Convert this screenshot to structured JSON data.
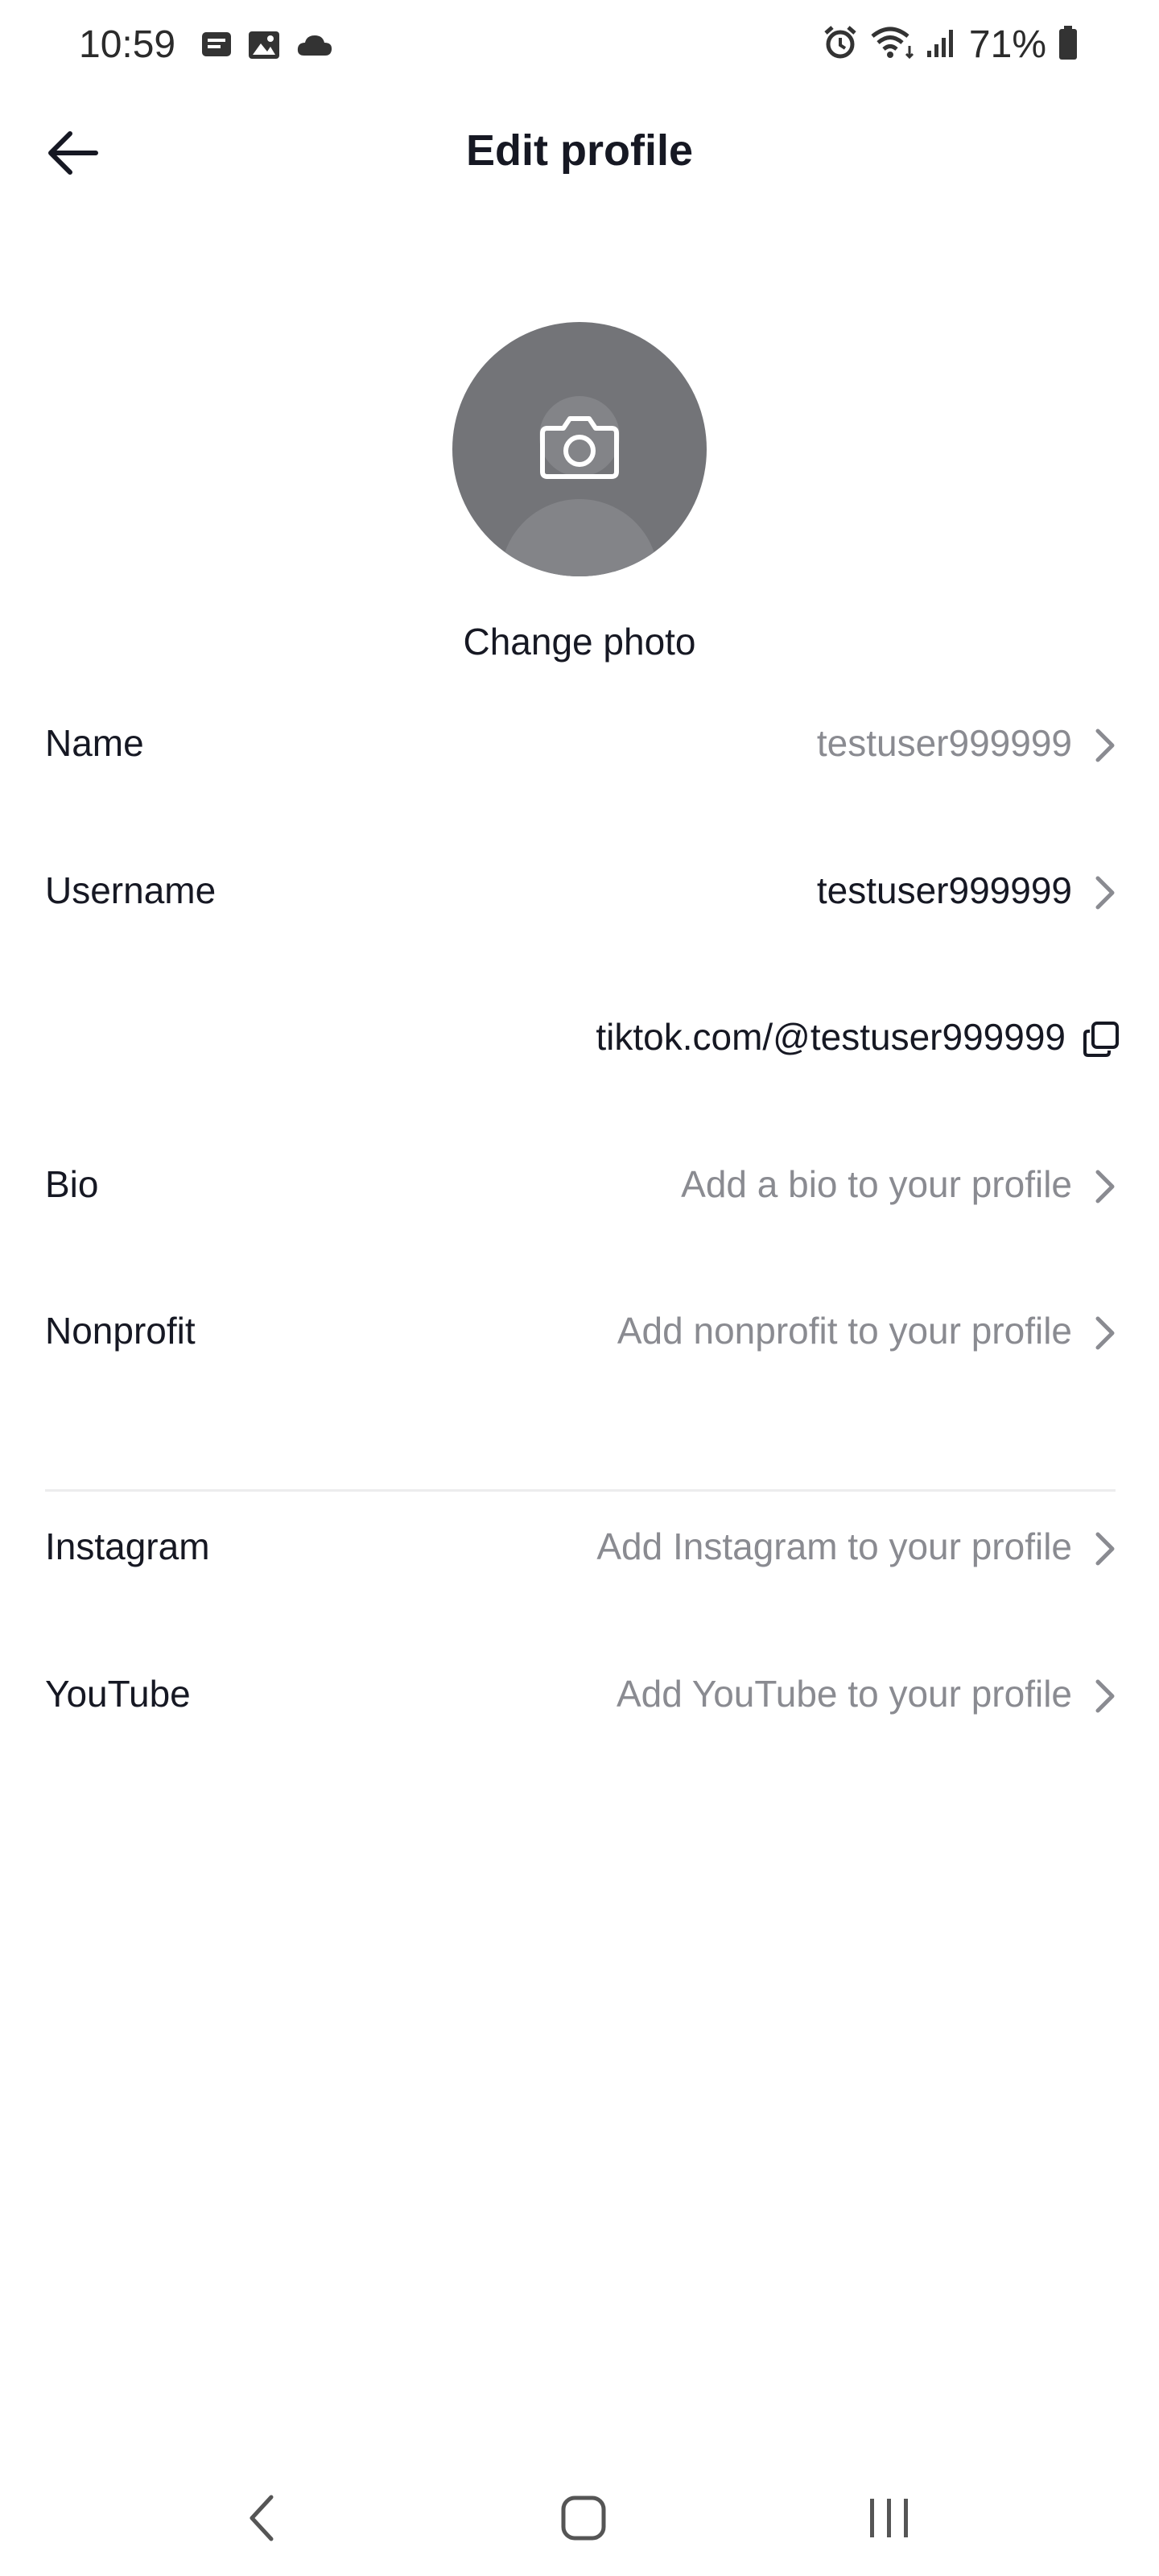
{
  "status_bar": {
    "time": "10:59",
    "battery": "71%",
    "left_icons": [
      "message-icon",
      "image-icon",
      "cloud-icon"
    ],
    "right_icons": [
      "alarm-icon",
      "wifi-icon",
      "signal-icon",
      "battery-icon"
    ]
  },
  "header": {
    "title": "Edit profile",
    "back_icon": "arrow-left-icon"
  },
  "profile": {
    "change_photo_label": "Change photo",
    "avatar_icon": "camera-icon"
  },
  "fields": {
    "name": {
      "label": "Name",
      "value": "testuser999999"
    },
    "username": {
      "label": "Username",
      "value": "testuser999999"
    },
    "link": {
      "value": "tiktok.com/@testuser999999"
    },
    "bio": {
      "label": "Bio",
      "value": "Add a bio to your profile"
    },
    "nonprofit": {
      "label": "Nonprofit",
      "value": "Add nonprofit to your profile"
    },
    "instagram": {
      "label": "Instagram",
      "value": "Add Instagram to your profile"
    },
    "youtube": {
      "label": "YouTube",
      "value": "Add YouTube to your profile"
    }
  },
  "nav_bar": {
    "icons": [
      "back-nav-icon",
      "home-nav-icon",
      "recents-nav-icon"
    ]
  },
  "colors": {
    "text_primary": "#161823",
    "text_secondary": "#8a8b91",
    "avatar_bg": "#737478",
    "divider": "#ececed"
  }
}
